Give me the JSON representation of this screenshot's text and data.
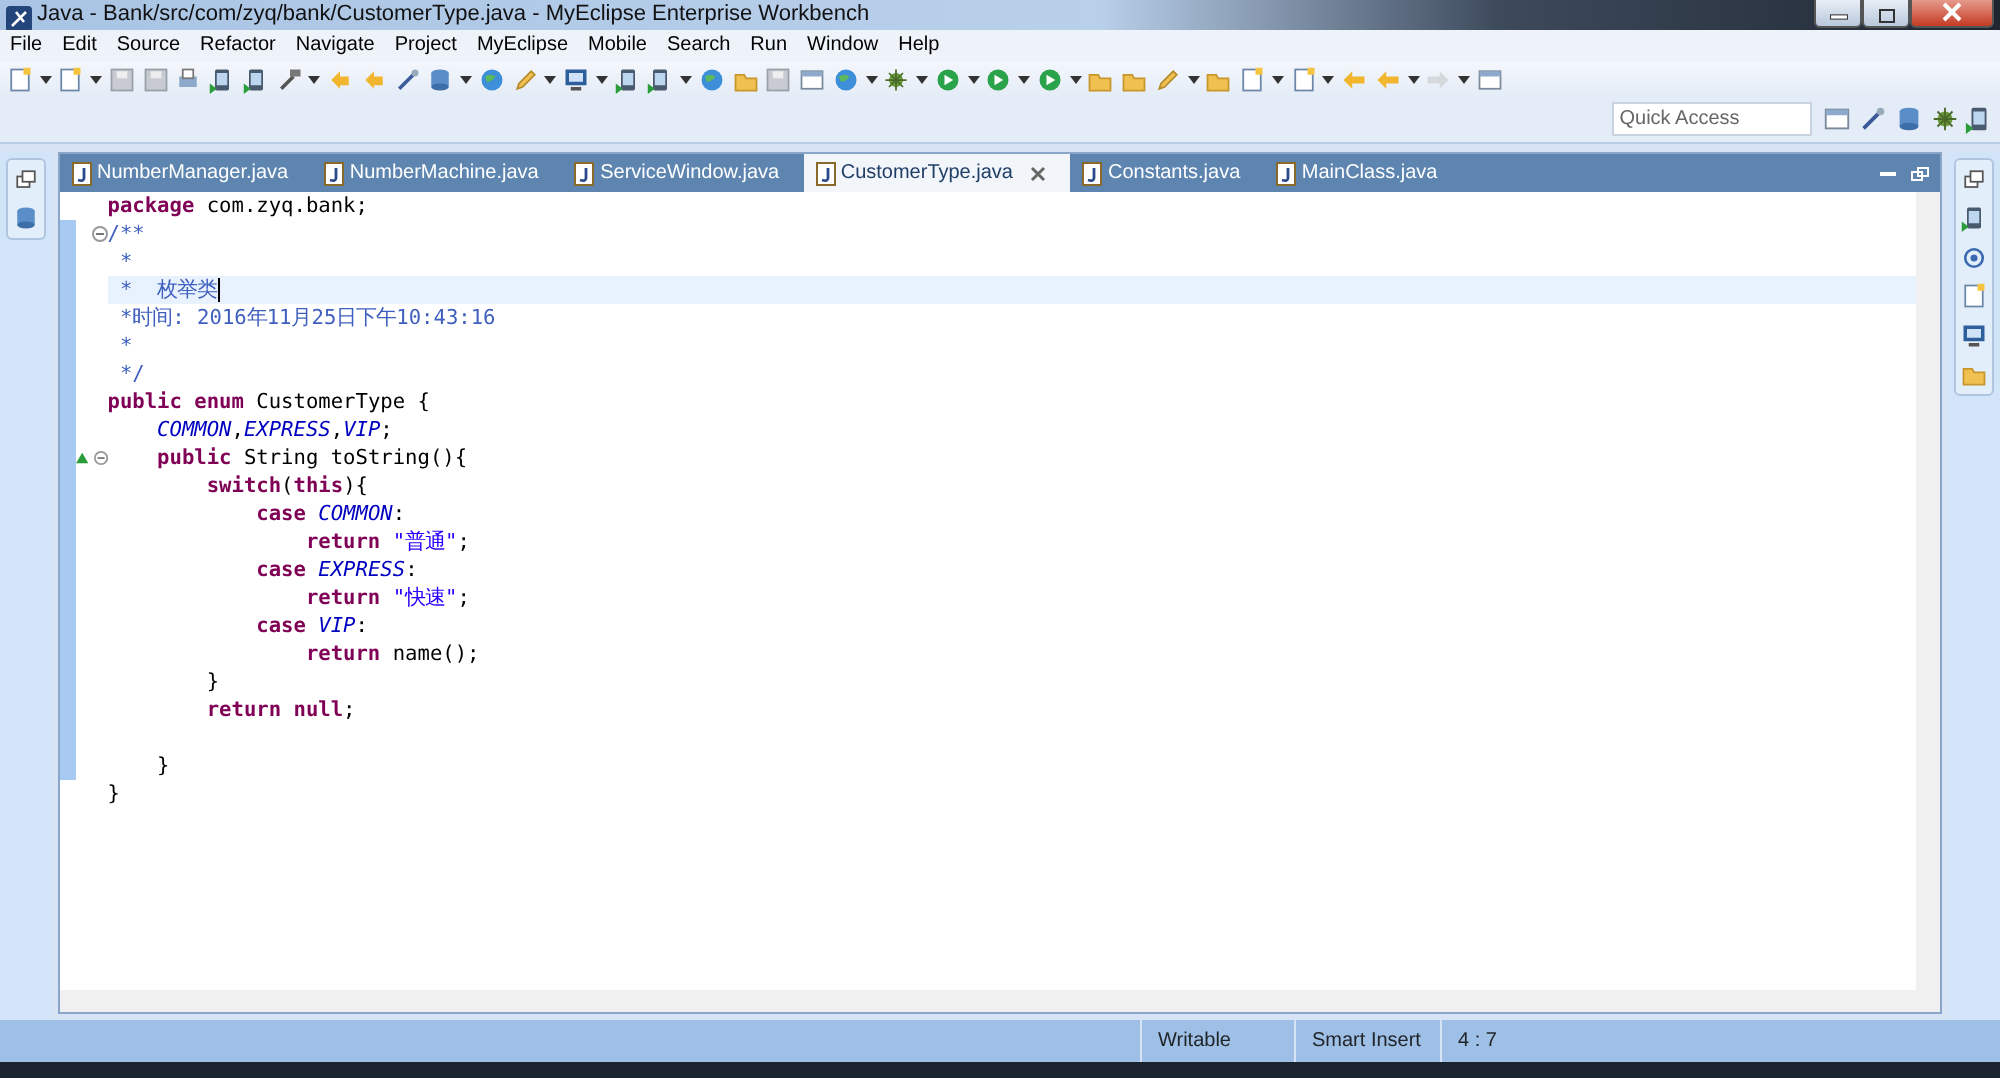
{
  "window": {
    "title": "Java - Bank/src/com/zyq/bank/CustomerType.java - MyEclipse Enterprise Workbench"
  },
  "menu": [
    "File",
    "Edit",
    "Source",
    "Refactor",
    "Navigate",
    "Project",
    "MyEclipse",
    "Mobile",
    "Search",
    "Run",
    "Window",
    "Help"
  ],
  "quick_access": {
    "placeholder": "Quick Access"
  },
  "editor_tabs": [
    {
      "label": "NumberManager.java",
      "selected": false
    },
    {
      "label": "NumberMachine.java",
      "selected": false
    },
    {
      "label": "ServiceWindow.java",
      "selected": false
    },
    {
      "label": "CustomerType.java",
      "selected": true
    },
    {
      "label": "Constants.java",
      "selected": false
    },
    {
      "label": "MainClass.java",
      "selected": false
    }
  ],
  "code_lines": [
    {
      "current": false,
      "fold": false,
      "override": false,
      "tokens": [
        {
          "kind": "keyword",
          "text": "package"
        },
        {
          "kind": "text",
          "text": " com.zyq.bank;"
        }
      ]
    },
    {
      "current": false,
      "fold": true,
      "override": false,
      "tokens": [
        {
          "kind": "comment",
          "text": "/**"
        }
      ]
    },
    {
      "current": false,
      "fold": false,
      "override": false,
      "tokens": [
        {
          "kind": "comment",
          "text": " *"
        }
      ]
    },
    {
      "current": true,
      "fold": false,
      "override": false,
      "tokens": [
        {
          "kind": "comment",
          "text": " *  枚举类"
        }
      ]
    },
    {
      "current": false,
      "fold": false,
      "override": false,
      "tokens": [
        {
          "kind": "comment",
          "text": " *时间: 2016年11月25日下午10:43:16"
        }
      ]
    },
    {
      "current": false,
      "fold": false,
      "override": false,
      "tokens": [
        {
          "kind": "comment",
          "text": " *"
        }
      ]
    },
    {
      "current": false,
      "fold": false,
      "override": false,
      "tokens": [
        {
          "kind": "comment",
          "text": " */"
        }
      ]
    },
    {
      "current": false,
      "fold": false,
      "override": false,
      "tokens": [
        {
          "kind": "keyword",
          "text": "public enum"
        },
        {
          "kind": "text",
          "text": " CustomerType {"
        }
      ]
    },
    {
      "current": false,
      "fold": false,
      "override": false,
      "tokens": [
        {
          "kind": "constant",
          "text": "    COMMON"
        },
        {
          "kind": "text",
          "text": ","
        },
        {
          "kind": "constant",
          "text": "EXPRESS"
        },
        {
          "kind": "text",
          "text": ","
        },
        {
          "kind": "constant",
          "text": "VIP"
        },
        {
          "kind": "text",
          "text": ";"
        }
      ]
    },
    {
      "current": false,
      "fold": true,
      "override": true,
      "tokens": [
        {
          "kind": "keyword",
          "text": "    public"
        },
        {
          "kind": "text",
          "text": " String toString(){"
        }
      ]
    },
    {
      "current": false,
      "fold": false,
      "override": false,
      "tokens": [
        {
          "kind": "keyword",
          "text": "        switch"
        },
        {
          "kind": "text",
          "text": "("
        },
        {
          "kind": "keyword",
          "text": "this"
        },
        {
          "kind": "text",
          "text": "){"
        }
      ]
    },
    {
      "current": false,
      "fold": false,
      "override": false,
      "tokens": [
        {
          "kind": "keyword",
          "text": "            case"
        },
        {
          "kind": "constant",
          "text": " COMMON"
        },
        {
          "kind": "text",
          "text": ":"
        }
      ]
    },
    {
      "current": false,
      "fold": false,
      "override": false,
      "tokens": [
        {
          "kind": "keyword",
          "text": "                return"
        },
        {
          "kind": "string",
          "text": " \"普通\""
        },
        {
          "kind": "text",
          "text": ";"
        }
      ]
    },
    {
      "current": false,
      "fold": false,
      "override": false,
      "tokens": [
        {
          "kind": "keyword",
          "text": "            case"
        },
        {
          "kind": "constant",
          "text": " EXPRESS"
        },
        {
          "kind": "text",
          "text": ":"
        }
      ]
    },
    {
      "current": false,
      "fold": false,
      "override": false,
      "tokens": [
        {
          "kind": "keyword",
          "text": "                return"
        },
        {
          "kind": "string",
          "text": " \"快速\""
        },
        {
          "kind": "text",
          "text": ";"
        }
      ]
    },
    {
      "current": false,
      "fold": false,
      "override": false,
      "tokens": [
        {
          "kind": "keyword",
          "text": "            case"
        },
        {
          "kind": "constant",
          "text": " VIP"
        },
        {
          "kind": "text",
          "text": ":"
        }
      ]
    },
    {
      "current": false,
      "fold": false,
      "override": false,
      "tokens": [
        {
          "kind": "keyword",
          "text": "                return"
        },
        {
          "kind": "text",
          "text": " name();"
        }
      ]
    },
    {
      "current": false,
      "fold": false,
      "override": false,
      "tokens": [
        {
          "kind": "text",
          "text": "        }"
        }
      ]
    },
    {
      "current": false,
      "fold": false,
      "override": false,
      "tokens": [
        {
          "kind": "keyword",
          "text": "        return null"
        },
        {
          "kind": "text",
          "text": ";"
        }
      ]
    },
    {
      "current": false,
      "fold": false,
      "override": false
    },
    {
      "current": false,
      "fold": false,
      "override": false,
      "tokens": [
        {
          "kind": "text",
          "text": "    }"
        }
      ]
    },
    {
      "current": false,
      "fold": false,
      "override": false,
      "tokens": [
        {
          "kind": "text",
          "text": "}"
        }
      ]
    }
  ],
  "status_bar": {
    "fields": [
      "Writable",
      "Smart Insert",
      "4 : 7"
    ]
  }
}
